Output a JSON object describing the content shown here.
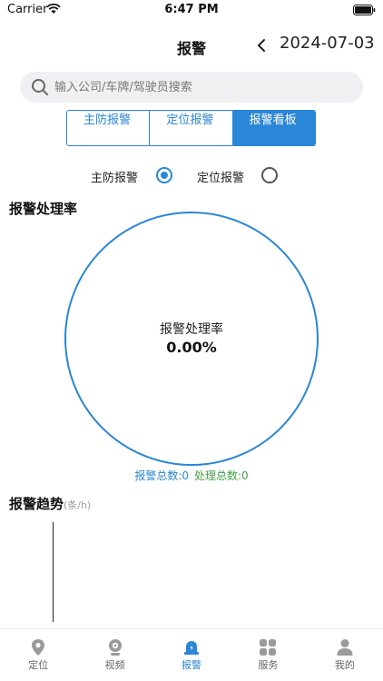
{
  "status_bar": {
    "carrier": "Carrier",
    "time": "6:47 PM"
  },
  "nav": {
    "title": "报警",
    "date": "2024-07-03"
  },
  "search": {
    "placeholder": "输入公司/车牌/驾驶员搜索",
    "value": ""
  },
  "segments": [
    {
      "label": "主防报警",
      "active": false
    },
    {
      "label": "定位报警",
      "active": false
    },
    {
      "label": "报警看板",
      "active": true
    }
  ],
  "radios": [
    {
      "label": "主防报警",
      "checked": true
    },
    {
      "label": "定位报警",
      "checked": false
    }
  ],
  "rate_section": {
    "title": "报警处理率",
    "center_label": "报警处理率",
    "center_value": "0.00%",
    "total_alarms": "报警总数:0",
    "total_handled": "处理总数:0"
  },
  "trend_section": {
    "title": "报警趋势",
    "unit": "(条/h)"
  },
  "tab_bar": [
    {
      "label": "定位",
      "icon": "location-icon",
      "active": false
    },
    {
      "label": "视频",
      "icon": "camera-icon",
      "active": false
    },
    {
      "label": "报警",
      "icon": "alarm-bell-icon",
      "active": true
    },
    {
      "label": "服务",
      "icon": "grid-icon",
      "active": false
    },
    {
      "label": "我的",
      "icon": "person-icon",
      "active": false
    }
  ],
  "colors": {
    "accent": "#2a86d6",
    "handled": "#43a047"
  }
}
